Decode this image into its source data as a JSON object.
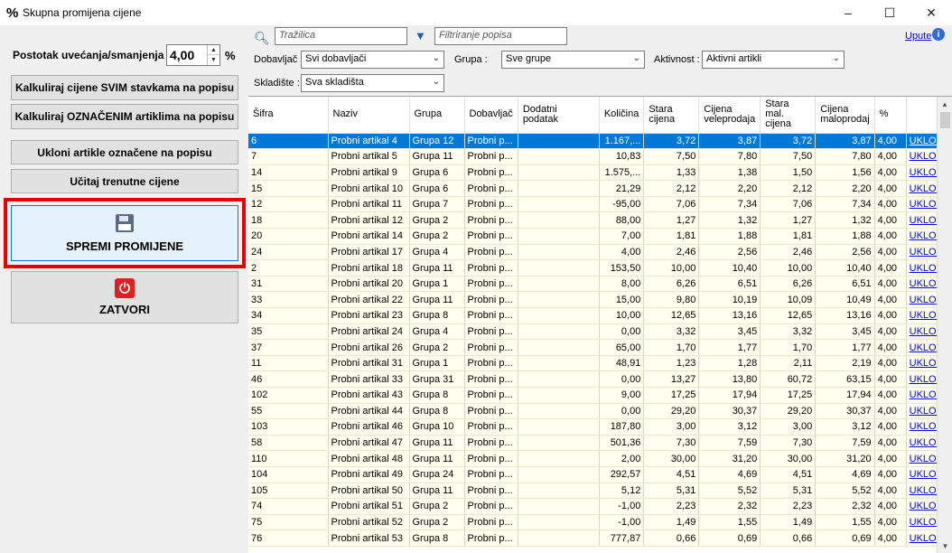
{
  "window": {
    "icon": "%",
    "title": "Skupna promijena cijene",
    "min": "–",
    "max": "☐",
    "close": "✕"
  },
  "left": {
    "pct_label": "Postotak uvećanja/smanjenja :",
    "pct_value": "4,00",
    "pct_sign": "%",
    "btn_calc_all": "Kalkuliraj cijene SVIM stavkama na popisu",
    "btn_calc_marked": "Kalkuliraj OZNAČENIM artiklima na popisu",
    "btn_remove": "Ukloni artikle označene na popisu",
    "btn_load": "Učitaj trenutne cijene",
    "btn_save": "SPREMI PROMIJENE",
    "btn_close": "ZATVORI"
  },
  "filters": {
    "search_placeholder": "Tražilica",
    "filter_placeholder": "Filtriranje popisa",
    "help": "Upute",
    "supplier_label": "Dobavljač :",
    "supplier_value": "Svi dobavljači",
    "group_label": "Grupa :",
    "group_value": "Sve grupe",
    "activity_label": "Aktivnost :",
    "activity_value": "Aktivni artikli",
    "warehouse_label": "Skladište :",
    "warehouse_value": "Sva skladišta"
  },
  "table": {
    "headers": [
      "Šifra",
      "Naziv",
      "Grupa",
      "Dobavljač",
      "Dodatni podatak",
      "Količina",
      "Stara cijena",
      "Cijena veleprodaja",
      "Stara mal. cijena",
      "Cijena maloprodaj",
      "%",
      ""
    ],
    "rows": [
      [
        "6",
        "Probni artikal 4",
        "Grupa 12",
        "Probni p...",
        "",
        "1.167,...",
        "3,72",
        "3,87",
        "3,72",
        "3,87",
        "4,00",
        "UKLONI"
      ],
      [
        "7",
        "Probni artikal 5",
        "Grupa 11",
        "Probni p...",
        "",
        "10,83",
        "7,50",
        "7,80",
        "7,50",
        "7,80",
        "4,00",
        "UKLONI"
      ],
      [
        "14",
        "Probni artikal 9",
        "Grupa 6",
        "Probni p...",
        "",
        "1.575,...",
        "1,33",
        "1,38",
        "1,50",
        "1,56",
        "4,00",
        "UKLONI"
      ],
      [
        "15",
        "Probni artikal 10",
        "Grupa 6",
        "Probni p...",
        "",
        "21,29",
        "2,12",
        "2,20",
        "2,12",
        "2,20",
        "4,00",
        "UKLONI"
      ],
      [
        "12",
        "Probni artikal 11",
        "Grupa 7",
        "Probni p...",
        "",
        "-95,00",
        "7,06",
        "7,34",
        "7,06",
        "7,34",
        "4,00",
        "UKLONI"
      ],
      [
        "18",
        "Probni artikal 12",
        "Grupa 2",
        "Probni p...",
        "",
        "88,00",
        "1,27",
        "1,32",
        "1,27",
        "1,32",
        "4,00",
        "UKLONI"
      ],
      [
        "20",
        "Probni artikal 14",
        "Grupa 2",
        "Probni p...",
        "",
        "7,00",
        "1,81",
        "1,88",
        "1,81",
        "1,88",
        "4,00",
        "UKLONI"
      ],
      [
        "24",
        "Probni artikal 17",
        "Grupa 4",
        "Probni p...",
        "",
        "4,00",
        "2,46",
        "2,56",
        "2,46",
        "2,56",
        "4,00",
        "UKLONI"
      ],
      [
        "2",
        "Probni artikal 18",
        "Grupa 11",
        "Probni p...",
        "",
        "153,50",
        "10,00",
        "10,40",
        "10,00",
        "10,40",
        "4,00",
        "UKLONI"
      ],
      [
        "31",
        "Probni artikal 20",
        "Grupa 1",
        "Probni p...",
        "",
        "8,00",
        "6,26",
        "6,51",
        "6,26",
        "6,51",
        "4,00",
        "UKLONI"
      ],
      [
        "33",
        "Probni artikal 22",
        "Grupa 11",
        "Probni p...",
        "",
        "15,00",
        "9,80",
        "10,19",
        "10,09",
        "10,49",
        "4,00",
        "UKLONI"
      ],
      [
        "34",
        "Probni artikal 23",
        "Grupa 8",
        "Probni p...",
        "",
        "10,00",
        "12,65",
        "13,16",
        "12,65",
        "13,16",
        "4,00",
        "UKLONI"
      ],
      [
        "35",
        "Probni artikal 24",
        "Grupa 4",
        "Probni p...",
        "",
        "0,00",
        "3,32",
        "3,45",
        "3,32",
        "3,45",
        "4,00",
        "UKLONI"
      ],
      [
        "37",
        "Probni artikal 26",
        "Grupa 2",
        "Probni p...",
        "",
        "65,00",
        "1,70",
        "1,77",
        "1,70",
        "1,77",
        "4,00",
        "UKLONI"
      ],
      [
        "11",
        "Probni artikal 31",
        "Grupa 1",
        "Probni p...",
        "",
        "48,91",
        "1,23",
        "1,28",
        "2,11",
        "2,19",
        "4,00",
        "UKLONI"
      ],
      [
        "46",
        "Probni artikal 33",
        "Grupa 31",
        "Probni p...",
        "",
        "0,00",
        "13,27",
        "13,80",
        "60,72",
        "63,15",
        "4,00",
        "UKLONI"
      ],
      [
        "102",
        "Probni artikal 43",
        "Grupa 8",
        "Probni p...",
        "",
        "9,00",
        "17,25",
        "17,94",
        "17,25",
        "17,94",
        "4,00",
        "UKLONI"
      ],
      [
        "55",
        "Probni artikal 44",
        "Grupa 8",
        "Probni p...",
        "",
        "0,00",
        "29,20",
        "30,37",
        "29,20",
        "30,37",
        "4,00",
        "UKLONI"
      ],
      [
        "103",
        "Probni artikal 46",
        "Grupa 10",
        "Probni p...",
        "",
        "187,80",
        "3,00",
        "3,12",
        "3,00",
        "3,12",
        "4,00",
        "UKLONI"
      ],
      [
        "58",
        "Probni artikal 47",
        "Grupa 11",
        "Probni p...",
        "",
        "501,36",
        "7,30",
        "7,59",
        "7,30",
        "7,59",
        "4,00",
        "UKLONI"
      ],
      [
        "110",
        "Probni artikal 48",
        "Grupa 11",
        "Probni p...",
        "",
        "2,00",
        "30,00",
        "31,20",
        "30,00",
        "31,20",
        "4,00",
        "UKLONI"
      ],
      [
        "104",
        "Probni artikal 49",
        "Grupa 24",
        "Probni p...",
        "",
        "292,57",
        "4,51",
        "4,69",
        "4,51",
        "4,69",
        "4,00",
        "UKLONI"
      ],
      [
        "105",
        "Probni artikal 50",
        "Grupa 11",
        "Probni p...",
        "",
        "5,12",
        "5,31",
        "5,52",
        "5,31",
        "5,52",
        "4,00",
        "UKLONI"
      ],
      [
        "74",
        "Probni artikal 51",
        "Grupa 2",
        "Probni p...",
        "",
        "-1,00",
        "2,23",
        "2,32",
        "2,23",
        "2,32",
        "4,00",
        "UKLONI"
      ],
      [
        "75",
        "Probni artikal 52",
        "Grupa 2",
        "Probni p...",
        "",
        "-1,00",
        "1,49",
        "1,55",
        "1,49",
        "1,55",
        "4,00",
        "UKLONI"
      ],
      [
        "76",
        "Probni artikal 53",
        "Grupa 8",
        "Probni p...",
        "",
        "777,87",
        "0,66",
        "0,69",
        "0,66",
        "0,69",
        "4,00",
        "UKLONI"
      ]
    ]
  }
}
